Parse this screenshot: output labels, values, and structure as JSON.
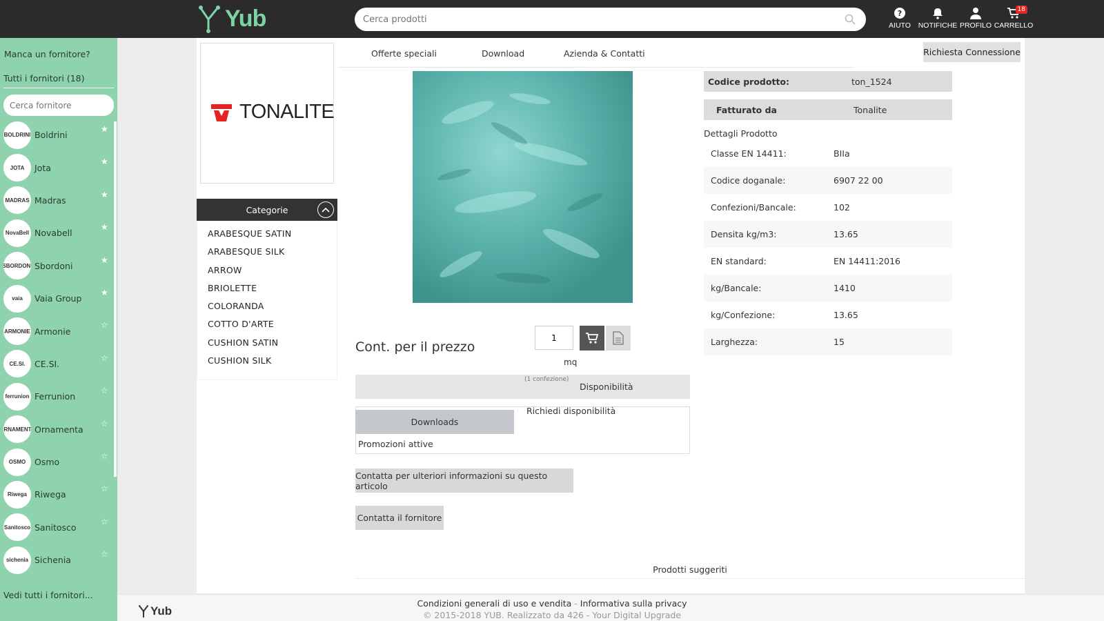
{
  "header": {
    "logo_text": "Yub",
    "search_placeholder": "Cerca prodotti",
    "icons": [
      {
        "label": "AIUTO",
        "icon": "help-icon"
      },
      {
        "label": "NOTIFICHE",
        "icon": "bell-icon"
      },
      {
        "label": "PROFILO",
        "icon": "user-icon"
      },
      {
        "label": "CARRELLO",
        "icon": "cart-icon"
      }
    ],
    "cart_count": "18"
  },
  "sidebar": {
    "missing": "Manca un fornitore?",
    "all": "Tutti i fornitori (18)",
    "search_placeholder": "Cerca fornitore",
    "suppliers": [
      {
        "name": "Boldrini",
        "logo": "BOLDRINI",
        "starred": true
      },
      {
        "name": "Jota",
        "logo": "JOTA",
        "starred": true
      },
      {
        "name": "Madras",
        "logo": "MADRAS",
        "starred": true
      },
      {
        "name": "Novabell",
        "logo": "NovaBell",
        "starred": true
      },
      {
        "name": "Sbordoni",
        "logo": "SBORDONI",
        "starred": true
      },
      {
        "name": "Vaia Group",
        "logo": "vaia",
        "starred": true
      },
      {
        "name": "Armonie",
        "logo": "ARMONIE",
        "starred": false
      },
      {
        "name": "CE.SI.",
        "logo": "CE.SI.",
        "starred": false
      },
      {
        "name": "Ferrunion",
        "logo": "ferrunion",
        "starred": false
      },
      {
        "name": "Ornamenta",
        "logo": "ORNAMENTA",
        "starred": false
      },
      {
        "name": "Osmo",
        "logo": "OSMO",
        "starred": false
      },
      {
        "name": "Riwega",
        "logo": "Riwega",
        "starred": false
      },
      {
        "name": "Sanitosco",
        "logo": "Sanitosco",
        "starred": false
      },
      {
        "name": "Sichenia",
        "logo": "sichenia",
        "starred": false
      }
    ],
    "see_all": "Vedi tutti i fornitori..."
  },
  "brand": {
    "name": "TONALITE"
  },
  "categories": {
    "title": "Categorie",
    "items": [
      "ARABESQUE SATIN",
      "ARABESQUE SILK",
      "ARROW",
      "BRIOLETTE",
      "COLORANDA",
      "COTTO D'ARTE",
      "CUSHION SATIN",
      "CUSHION SILK"
    ]
  },
  "tabs": [
    "Offerte speciali",
    "Download",
    "Azienda & Contatti"
  ],
  "request_connection": "Richiesta Connessione",
  "product": {
    "price_label": "Cont. per il prezzo",
    "qty": "1",
    "unit": "mq",
    "pack": "(1 confezione)",
    "availability": "Disponibilità",
    "downloads": "Downloads",
    "request_availability": "Richiedi disponibilità",
    "promotions": "Promozioni attive",
    "contact_info": "Contatta per ulteriori informazioni su questo articolo",
    "contact_supplier": "Contatta il fornitore",
    "code_label": "Codice prodotto:",
    "code_value": "ton_1524",
    "billed_label": "Fatturato da",
    "billed_value": "Tonalite",
    "details_title": "Dettagli Prodotto",
    "details": [
      {
        "k": "Classe EN 14411:",
        "v": "BIIa"
      },
      {
        "k": "Codice doganale:",
        "v": "6907 22 00"
      },
      {
        "k": "Confezioni/Bancale:",
        "v": "102"
      },
      {
        "k": "Densita kg/m3:",
        "v": "13.65"
      },
      {
        "k": "EN standard:",
        "v": "EN 14411:2016"
      },
      {
        "k": "kg/Bancale:",
        "v": "1410"
      },
      {
        "k": "kg/Confezione:",
        "v": "13.65"
      },
      {
        "k": "Larghezza:",
        "v": "15"
      }
    ]
  },
  "suggested": "Prodotti suggeriti",
  "footer": {
    "logo_text": "Yub",
    "terms": "Condizioni generali di uso e vendita",
    "privacy": "Informativa sulla privacy",
    "copyright": "© 2015-2018 YUB.  Realizzato da 426 - Your Digital Upgrade"
  },
  "colors": {
    "topbar": "#2b2b2b",
    "sidebar": "#8ed3ae",
    "brand_accent": "#7ed3a6",
    "badge": "#e52421",
    "tile": "#5cb0a9"
  }
}
